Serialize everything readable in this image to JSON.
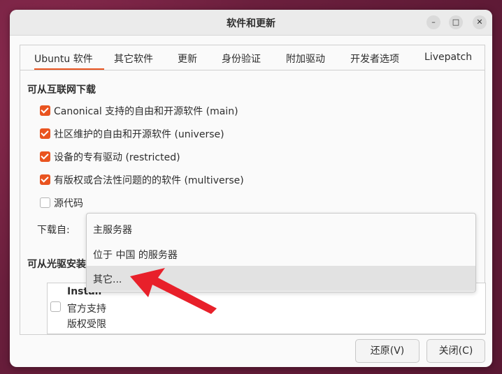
{
  "window": {
    "title": "软件和更新"
  },
  "tabs": [
    "Ubuntu 软件",
    "其它软件",
    "更新",
    "身份验证",
    "附加驱动",
    "开发者选项",
    "Livepatch"
  ],
  "internet_section": {
    "title": "可从互联网下载",
    "options": [
      {
        "label": "Canonical 支持的自由和开源软件 (main)",
        "checked": true
      },
      {
        "label": "社区维护的自由和开源软件 (universe)",
        "checked": true
      },
      {
        "label": "设备的专有驱动 (restricted)",
        "checked": true
      },
      {
        "label": "有版权或合法性问题的的软件 (multiverse)",
        "checked": true
      },
      {
        "label": "源代码",
        "checked": false
      }
    ],
    "download_from_label": "下载自:"
  },
  "download_dropdown": {
    "options": [
      "主服务器",
      "位于 中国 的服务器",
      "其它..."
    ],
    "highlighted": "其它..."
  },
  "cdrom_section": {
    "title": "可从光驱安装",
    "install_title": "Install",
    "install_line1": "官方支持",
    "install_line2": "版权受限"
  },
  "buttons": {
    "revert": "还原(V)",
    "close": "关闭(C)"
  },
  "colors": {
    "accent": "#e95420",
    "arrow": "#e8202a"
  }
}
